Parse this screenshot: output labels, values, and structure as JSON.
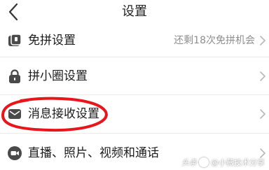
{
  "nav": {
    "title": "设置",
    "back_icon": "chevron-left-icon"
  },
  "rows": [
    {
      "id": "free-group",
      "icon": "pin-card-icon",
      "label": "免拼设置",
      "hint": "还剩18次免拼机会"
    },
    {
      "id": "circle",
      "icon": "lock-icon",
      "label": "拼小圈设置",
      "hint": ""
    },
    {
      "id": "message",
      "icon": "envelope-icon",
      "label": "消息接收设置",
      "hint": ""
    },
    {
      "id": "media",
      "icon": "video-camera-icon",
      "label": "直播、照片、视频和通话",
      "hint": ""
    }
  ],
  "watermark": {
    "brand": "头条",
    "handle": "@小薇技术分享"
  },
  "colors": {
    "highlight": "#e8161b",
    "text": "#1c1c1c",
    "hint": "#8e8e8e",
    "icon": "#4a4a4a",
    "divider": "#ececec"
  }
}
